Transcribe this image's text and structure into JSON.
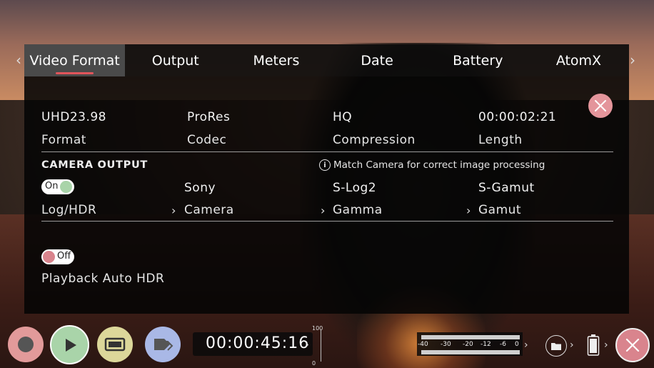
{
  "tabs": [
    {
      "label": "Video Format",
      "active": true
    },
    {
      "label": "Output",
      "active": false
    },
    {
      "label": "Meters",
      "active": false
    },
    {
      "label": "Date",
      "active": false
    },
    {
      "label": "Battery",
      "active": false
    },
    {
      "label": "AtomX",
      "active": false
    }
  ],
  "info": {
    "format_value": "UHD23.98",
    "format_label": "Format",
    "codec_value": "ProRes",
    "codec_label": "Codec",
    "compression_value": "HQ",
    "compression_label": "Compression",
    "length_value": "00:00:02:21",
    "length_label": "Length"
  },
  "camera_output": {
    "title": "CAMERA OUTPUT",
    "note": "Match Camera for correct image processing",
    "log_toggle": "On",
    "log_label": "Log/HDR",
    "camera_value": "Sony",
    "camera_label": "Camera",
    "gamma_value": "S-Log2",
    "gamma_label": "Gamma",
    "gamut_value": "S-Gamut",
    "gamut_label": "Gamut"
  },
  "playback": {
    "toggle": "Off",
    "label": "Playback Auto HDR"
  },
  "transport": {
    "timecode": "00:00:45:16",
    "volume_max": "100",
    "volume_min": "0"
  },
  "meter": {
    "labels": [
      "-40",
      "-30",
      "-20",
      "-12",
      "-6",
      "0"
    ]
  },
  "colors": {
    "accent": "#e0555b",
    "toggle_on": "#a9d4a9",
    "toggle_off": "#d9848d",
    "record": "#e29a9a",
    "play": "#a9d4a9",
    "monitor": "#dcd79a",
    "tag": "#a9b8e6"
  },
  "icons": [
    "record-icon",
    "play-icon",
    "monitor-icon",
    "tag-icon",
    "folder-icon",
    "battery-icon",
    "close-icon",
    "info-icon"
  ]
}
